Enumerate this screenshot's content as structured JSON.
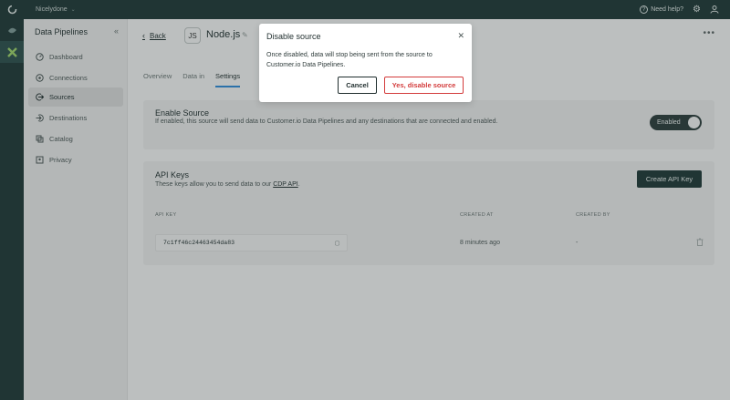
{
  "topbar": {
    "workspace": "Nicelydone",
    "help_label": "Need help?"
  },
  "sidebar": {
    "title": "Data Pipelines",
    "items": [
      {
        "label": "Dashboard",
        "icon": "gauge-icon"
      },
      {
        "label": "Connections",
        "icon": "connections-icon"
      },
      {
        "label": "Sources",
        "icon": "sources-icon",
        "active": true
      },
      {
        "label": "Destinations",
        "icon": "destinations-icon"
      },
      {
        "label": "Catalog",
        "icon": "catalog-icon"
      },
      {
        "label": "Privacy",
        "icon": "privacy-icon"
      }
    ]
  },
  "header": {
    "back_label": "Back",
    "source_name": "Node.js",
    "source_icon_text": "JS"
  },
  "tabs": [
    {
      "label": "Overview"
    },
    {
      "label": "Data in"
    },
    {
      "label": "Settings",
      "active": true
    }
  ],
  "enable_source": {
    "title": "Enable Source",
    "description": "If enabled, this source will send data to Customer.io Data Pipelines and any destinations that are connected and enabled.",
    "toggle_label": "Enabled"
  },
  "api_keys": {
    "title": "API Keys",
    "description_prefix": "These keys allow you to send data to our ",
    "description_link": "CDP API",
    "description_suffix": ".",
    "create_button": "Create API Key",
    "columns": [
      "API KEY",
      "CREATED AT",
      "CREATED BY"
    ],
    "rows": [
      {
        "key": "7c1ff46c24463454da83",
        "created_at": "8 minutes ago",
        "created_by": "-"
      }
    ]
  },
  "modal": {
    "title": "Disable source",
    "body": "Once disabled, data will stop being sent from the source to Customer.io Data Pipelines.",
    "cancel_label": "Cancel",
    "confirm_label": "Yes, disable source"
  },
  "colors": {
    "topbar": "#1f3836",
    "danger": "#d33b3b",
    "tab_active": "#2f8bd8"
  }
}
